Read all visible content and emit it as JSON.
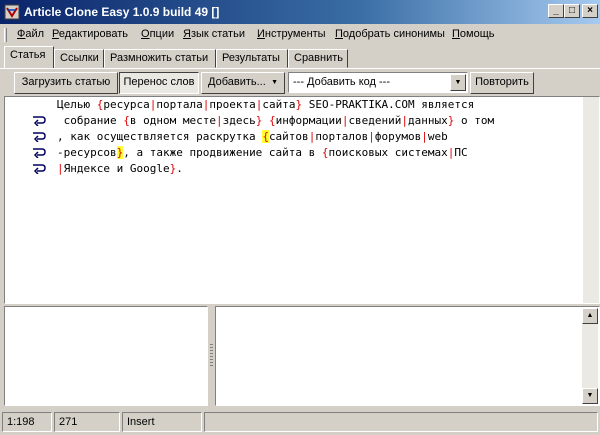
{
  "window": {
    "title": "Article Clone Easy 1.0.9 build 49 []"
  },
  "title_buttons": {
    "minimize": "_",
    "maximize": "□",
    "close": "×"
  },
  "menu": [
    {
      "first": "Ф",
      "rest": "айл"
    },
    {
      "first": "Р",
      "rest": "едактировать"
    },
    {
      "first": "О",
      "rest": "пции"
    },
    {
      "first": "Я",
      "rest": "зык статьи"
    },
    {
      "first": "И",
      "rest": "нструменты"
    },
    {
      "first": "П",
      "rest": "одобрать синонимы"
    },
    {
      "first": "П",
      "rest": "омощь"
    }
  ],
  "tabs": [
    "Статья",
    "Ссылки",
    "Размножить статьи",
    "Результаты",
    "Сравнить"
  ],
  "toolbar": {
    "load": "Загрузить статью",
    "wrap": "Перенос слов",
    "add": "Добавить...",
    "add_arrow": "▼",
    "code_combo": "--- Добавить код ---",
    "repeat": "Повторить"
  },
  "editor": {
    "lines": [
      "Целью {ресурса|портала|проекта|сайта} SEO-PRAKTIKA.COM является",
      " собрание {в одном месте|здесь} {информации|сведений|данных} о том",
      ", как осуществляется раскрутка {сайтов|порталов|форумов|web",
      "-ресурсов}, а также продвижение сайта в {поисковых системах|ПС",
      "|Яндексе и Google}."
    ],
    "highlight_open": {
      "line": 2,
      "char": 31
    },
    "highlight_close": {
      "line": 3,
      "char": 9
    }
  },
  "status": {
    "position": "1:198",
    "count": "271",
    "mode": "Insert"
  },
  "colors": {
    "syntax": "#e00000",
    "match_highlight": "#ffff33",
    "title_gradient_start": "#0a246a"
  },
  "icons": {
    "app": "app-icon",
    "wrap": "line-wrap-icon"
  }
}
